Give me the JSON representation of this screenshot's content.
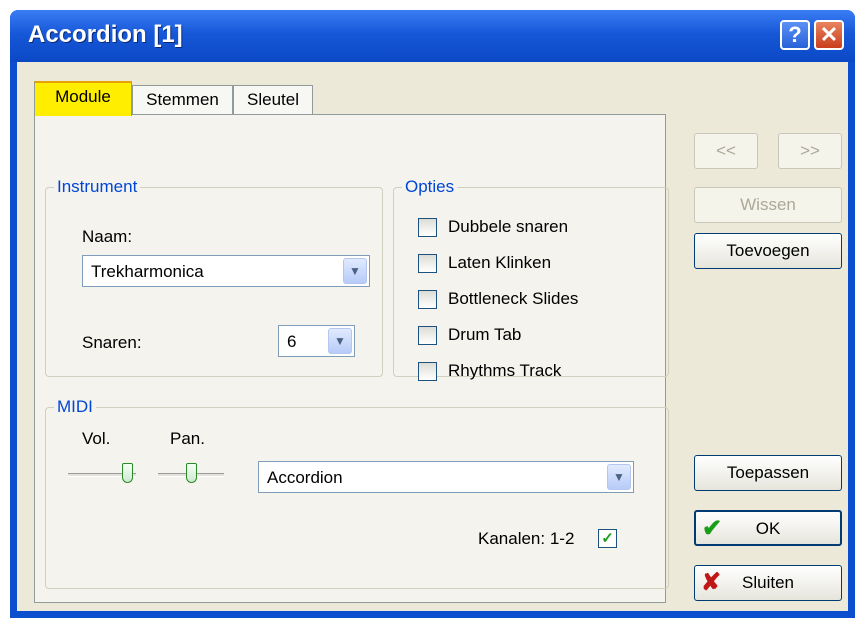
{
  "window": {
    "title": "Accordion [1]",
    "help_glyph": "?",
    "close_glyph": "✕"
  },
  "tabs": [
    {
      "label": "Module",
      "active": true
    },
    {
      "label": "Stemmen"
    },
    {
      "label": "Sleutel"
    }
  ],
  "instrument": {
    "legend": "Instrument",
    "naam_label": "Naam:",
    "naam_value": "Trekharmonica",
    "snaren_label": "Snaren:",
    "snaren_value": "6"
  },
  "opties": {
    "legend": "Opties",
    "items": [
      {
        "label": "Dubbele snaren",
        "checked": false
      },
      {
        "label": "Laten Klinken",
        "checked": false
      },
      {
        "label": "Bottleneck Slides",
        "checked": false
      },
      {
        "label": "Drum Tab",
        "checked": false
      },
      {
        "label": "Rhythms Track",
        "checked": false
      }
    ]
  },
  "midi": {
    "legend": "MIDI",
    "vol_label": "Vol.",
    "pan_label": "Pan.",
    "vol_level": 0.95,
    "pan_level": 0.5,
    "instrument_value": "Accordion",
    "kanalen_label": "Kanalen: 1-2",
    "kanalen_checked": true
  },
  "buttons": {
    "prev": "<<",
    "next": ">>",
    "wissen": "Wissen",
    "toevoegen": "Toevoegen",
    "toepassen": "Toepassen",
    "ok": "OK",
    "sluiten": "Sluiten"
  },
  "colors": {
    "title_bar": "#0b4fcf",
    "active_tab": "#ffee00",
    "group_legend": "#0046d5",
    "ok_icon": "#1a9e1a",
    "close_icon": "#c01818"
  },
  "icons": {
    "arrow": "chevron-down-icon",
    "check": "checkmark-icon",
    "ok": "green-check-icon",
    "sluiten": "red-x-icon"
  }
}
